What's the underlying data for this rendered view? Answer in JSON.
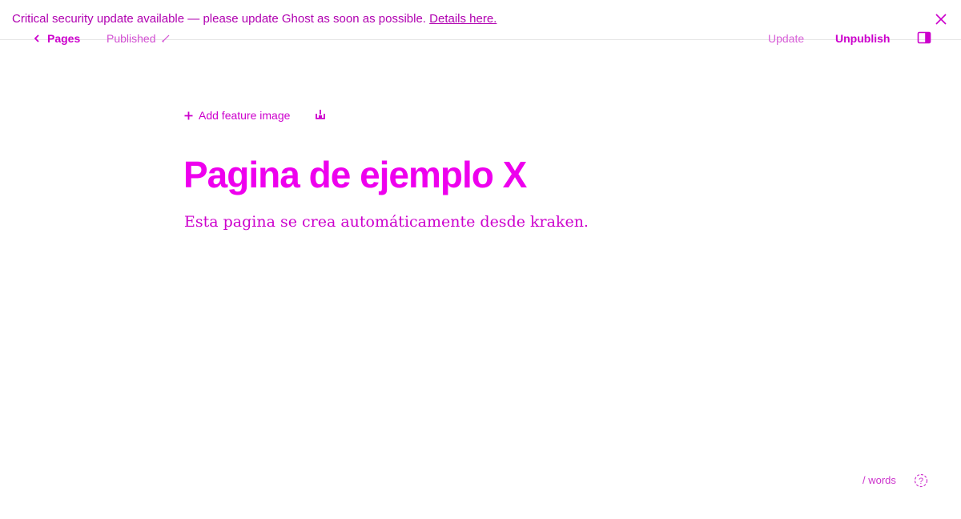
{
  "banner": {
    "message": "Critical security update available — please update Ghost as soon as possible.",
    "link_text": "Details here.",
    "close_icon": "close-icon"
  },
  "topbar": {
    "back_label": "Pages",
    "back_icon": "chevron-left-icon",
    "status": "Published",
    "status_icon": "pencil-icon",
    "update_label": "Update",
    "unpublish_label": "Unpublish",
    "sidebar_icon": "sidebar-toggle-icon"
  },
  "editor": {
    "feature_image_label": "Add feature image",
    "feature_image_icon": "plus-icon",
    "snippet_icon": "snippet-icon",
    "title": "Pagina de ejemplo X",
    "excerpt": "Esta pagina se crea automáticamente desde kraken."
  },
  "footer": {
    "word_count": "/ words",
    "help_icon": "help-icon"
  },
  "colors": {
    "accent": "#cc00cc",
    "title": "#ee00ee",
    "border": "#e6e6e6"
  }
}
